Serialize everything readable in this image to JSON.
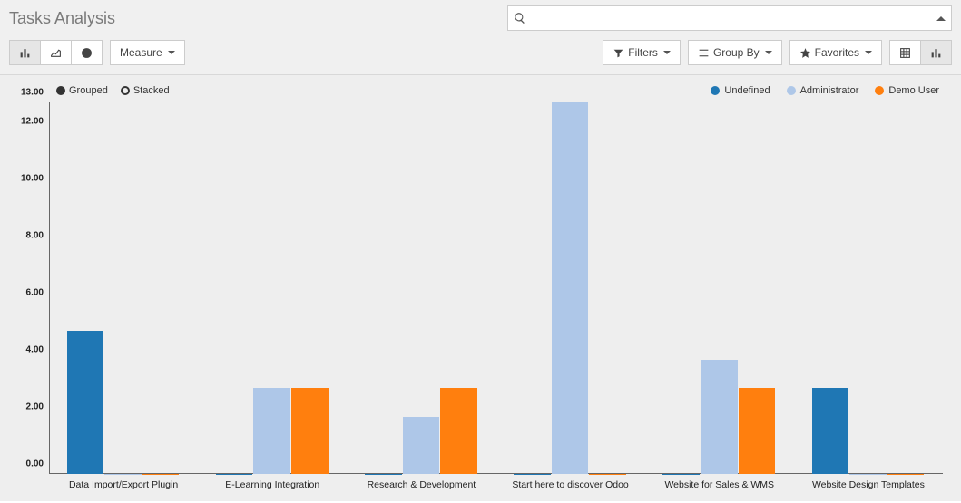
{
  "page_title": "Tasks Analysis",
  "search": {
    "placeholder": ""
  },
  "toolbar": {
    "measure_label": "Measure",
    "filters_label": "Filters",
    "groupby_label": "Group By",
    "favorites_label": "Favorites"
  },
  "stack_options": {
    "grouped": "Grouped",
    "stacked": "Stacked"
  },
  "chart_data": {
    "type": "bar",
    "ylabel": "",
    "xlabel": "",
    "ylim": [
      0,
      13
    ],
    "y_ticks": [
      "0.00",
      "2.00",
      "4.00",
      "6.00",
      "8.00",
      "10.00",
      "12.00"
    ],
    "y_extra_tick": "13.00",
    "categories": [
      "Data Import/Export Plugin",
      "E-Learning Integration",
      "Research & Development",
      "Start here to discover Odoo",
      "Website for Sales & WMS",
      "Website Design Templates"
    ],
    "series": [
      {
        "name": "Undefined",
        "color": "#1f77b4",
        "values": [
          5,
          0,
          0,
          0,
          0,
          3
        ]
      },
      {
        "name": "Administrator",
        "color": "#aec7e8",
        "values": [
          0,
          3,
          2,
          13,
          4,
          0
        ]
      },
      {
        "name": "Demo User",
        "color": "#ff7f0e",
        "values": [
          0,
          3,
          3,
          0,
          3,
          0
        ]
      }
    ]
  }
}
